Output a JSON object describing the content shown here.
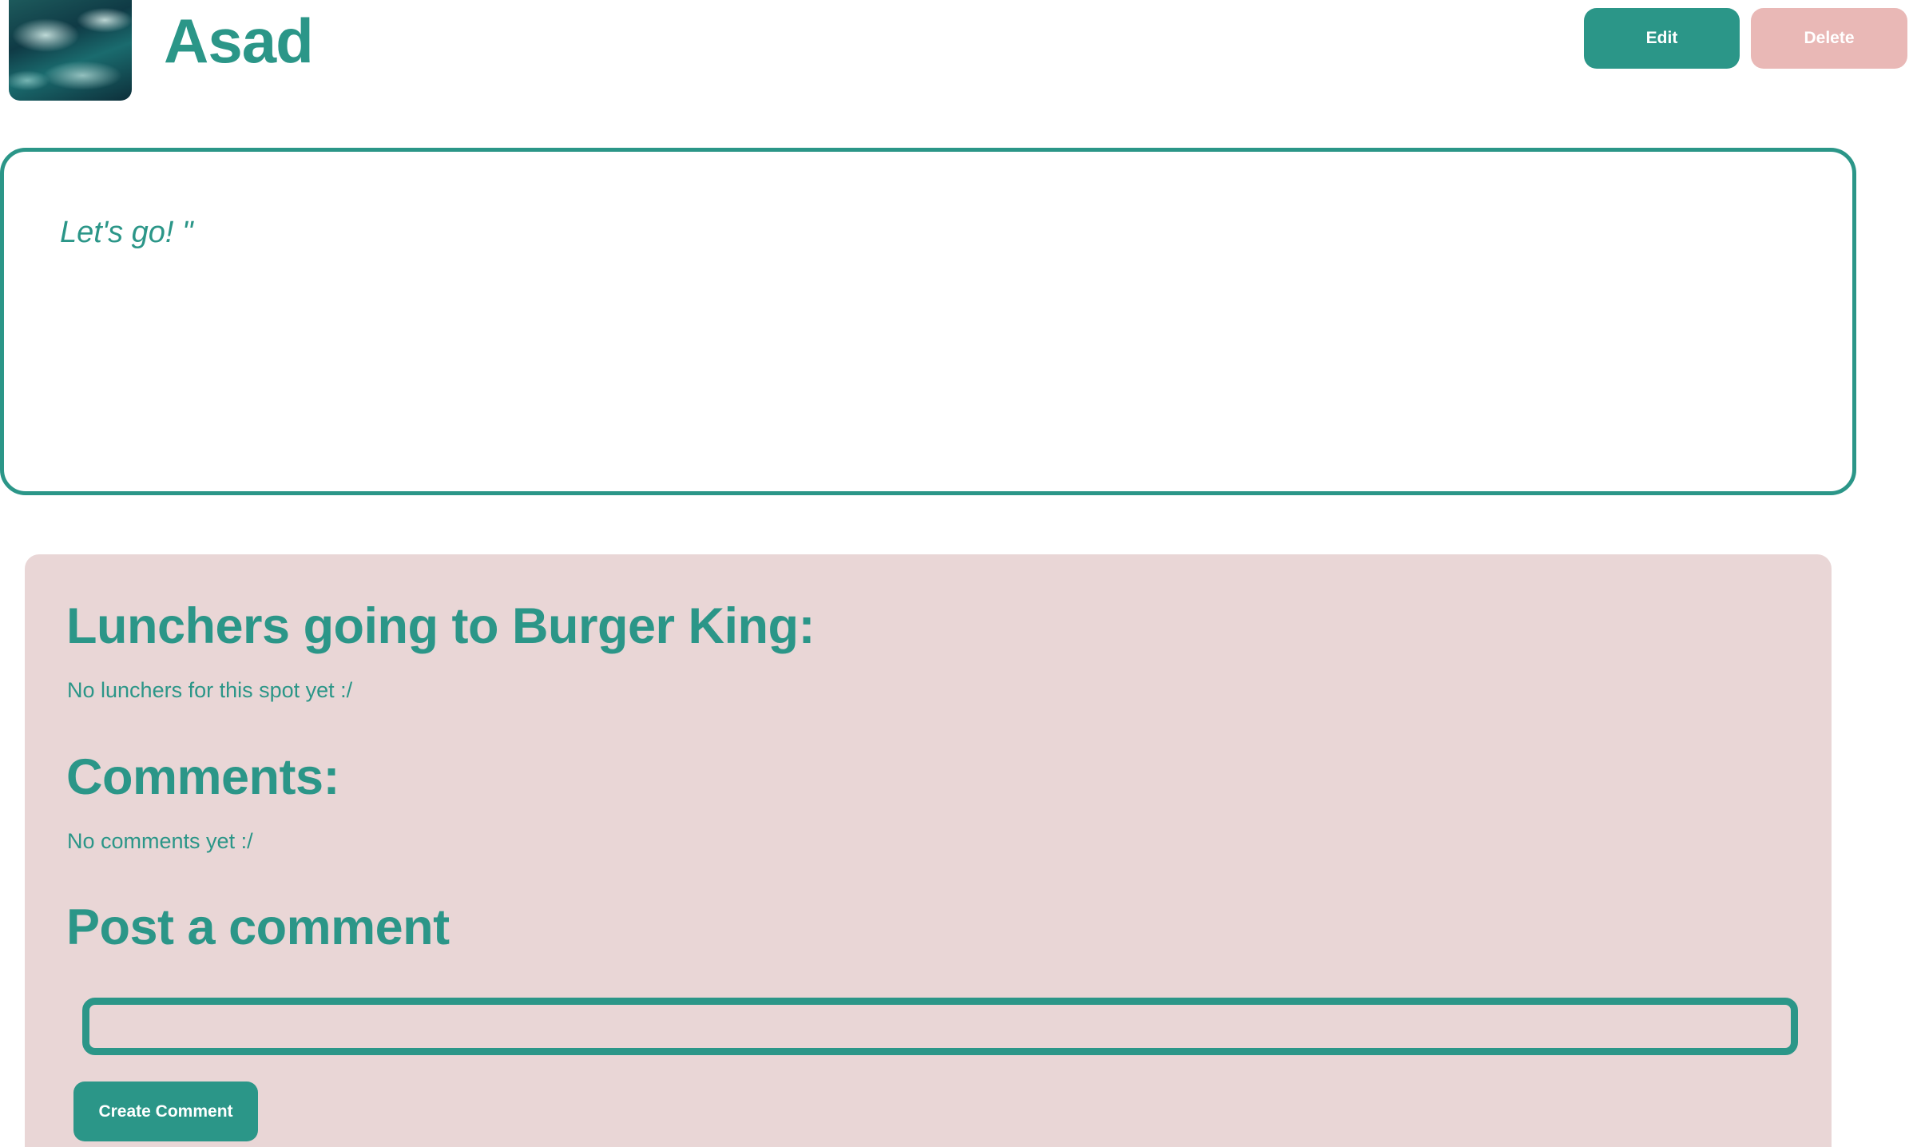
{
  "header": {
    "avatar_icon": "ocean-wave-photo",
    "username": "Asad",
    "edit_label": "Edit",
    "delete_label": "Delete"
  },
  "post": {
    "message": "Let's go! \""
  },
  "panel": {
    "lunchers_heading": "Lunchers going to Burger King:",
    "lunchers_empty": "No lunchers for this spot yet :/",
    "comments_heading": "Comments:",
    "comments_empty": "No comments yet :/",
    "post_heading": "Post a comment",
    "comment_input_value": "",
    "comment_input_placeholder": "",
    "create_comment_label": "Create Comment"
  },
  "colors": {
    "accent": "#2b9688",
    "delete_button": "#e9b8b6",
    "panel_background": "#e9d6d6",
    "page_background": "#ffffff"
  }
}
